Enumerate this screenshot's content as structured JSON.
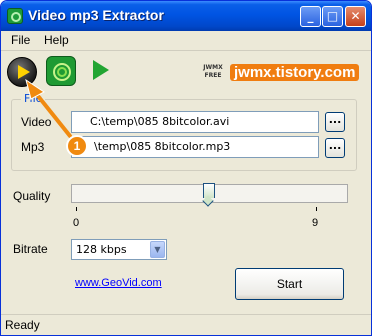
{
  "window": {
    "title": "Video mp3 Extractor"
  },
  "menu": {
    "file": "File",
    "help": "Help"
  },
  "titlebar_buttons": {
    "minimize": "_",
    "maximize": "□",
    "close": "✕"
  },
  "toolbar": {
    "badge": "JWMX\nFREE",
    "brand_text": "jwmx.tistory.com"
  },
  "file_group": {
    "legend": "File",
    "video_label": "Video",
    "video_path": "C:\\temp\\085 8bitcolor.avi",
    "mp3_label": "Mp3",
    "mp3_path": "\\temp\\085 8bitcolor.mp3",
    "browse_label": "..."
  },
  "quality": {
    "label": "Quality",
    "min": "0",
    "max": "9",
    "value": 5
  },
  "bitrate": {
    "label": "Bitrate",
    "selected": "128 kbps"
  },
  "link_text": "www.GeoVid.com",
  "start_label": "Start",
  "status": "Ready",
  "callout": {
    "number": "1"
  },
  "colors": {
    "title_bar": "#0054e3",
    "callout": "#f08a10",
    "brand": "#f07d10"
  }
}
